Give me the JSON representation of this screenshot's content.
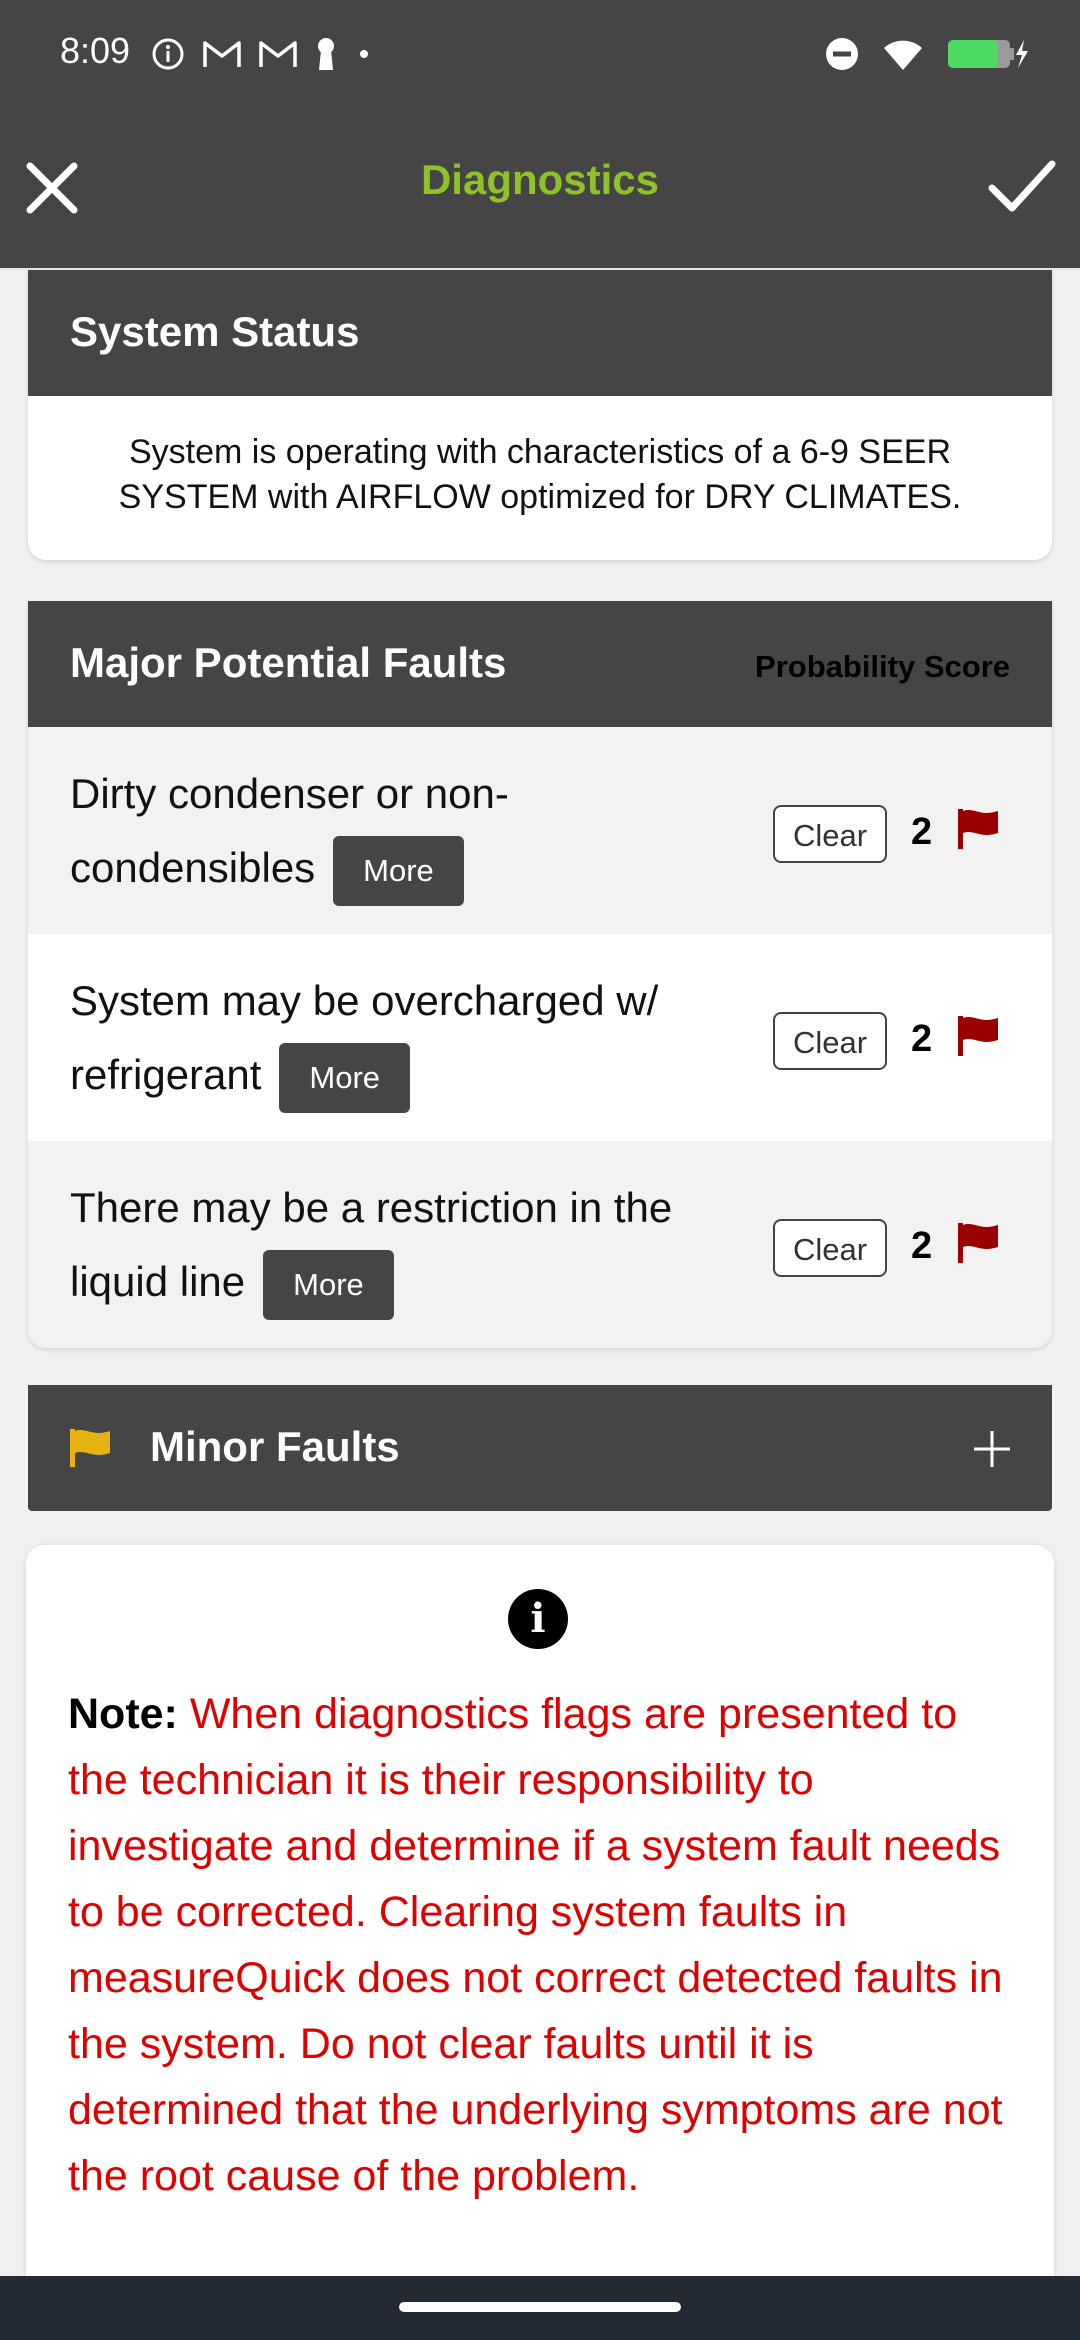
{
  "status_bar": {
    "time": "8:09",
    "icons_left": [
      "info-circle-icon",
      "gmail-icon",
      "gmail-icon",
      "keyhole-icon",
      "dot-icon"
    ],
    "icons_right": [
      "do-not-disturb-icon",
      "wifi-icon",
      "battery-charging-icon"
    ]
  },
  "app_bar": {
    "title": "Diagnostics",
    "title_color": "#8fc226",
    "close_icon": "close-icon",
    "confirm_icon": "check-icon"
  },
  "system_status": {
    "title": "System Status",
    "text": "System is operating with characteristics of a 6-9 SEER SYSTEM with AIRFLOW optimized for DRY CLIMATES."
  },
  "major_faults": {
    "title": "Major Potential Faults",
    "score_label": "Probability Score",
    "items": [
      {
        "text": "Dirty condenser or non-condensibles",
        "more_label": "More",
        "clear_label": "Clear",
        "score": "2"
      },
      {
        "text": "System may be overcharged w/ refrigerant",
        "more_label": "More",
        "clear_label": "Clear",
        "score": "2"
      },
      {
        "text": "There may be a restriction in the liquid line",
        "more_label": "More",
        "clear_label": "Clear",
        "score": "2"
      }
    ],
    "flag_color": "#9b0000"
  },
  "minor_faults": {
    "title": "Minor Faults",
    "flag_color": "#e6b412",
    "expand_icon": "plus-icon"
  },
  "note": {
    "label": "Note:",
    "text": "When diagnostics flags are presented to the technician it is their responsibility to investigate and determine if a system fault needs to be corrected. Clearing system faults in measureQuick does not correct detected faults in the system. Do not clear faults until it is determined that the underlying symptoms are not the root cause of the problem.",
    "text_color": "#e00000",
    "info_symbol": "i"
  }
}
